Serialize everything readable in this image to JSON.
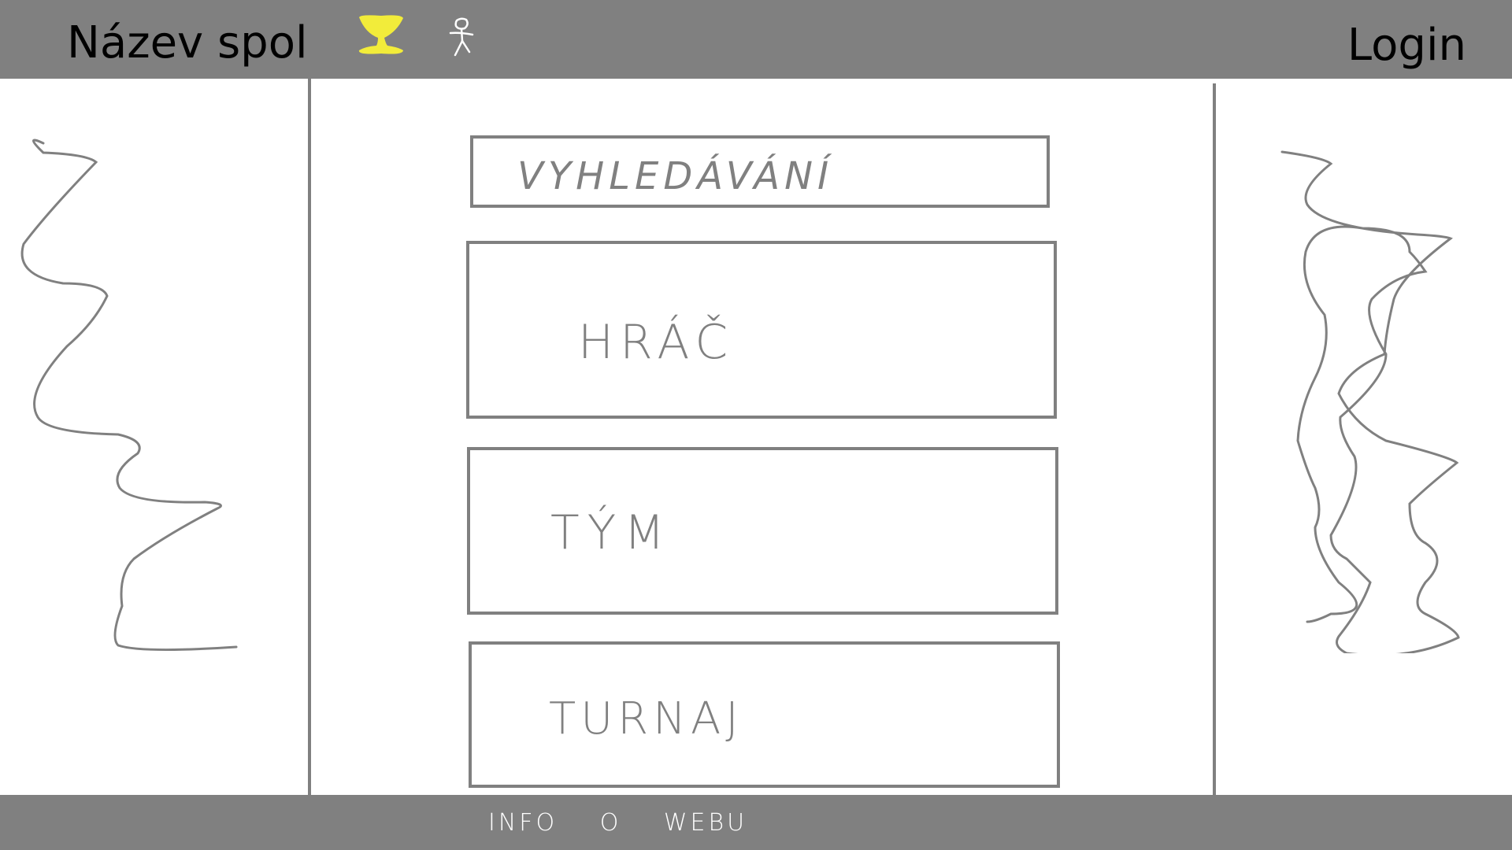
{
  "header": {
    "company_name": "Název spol",
    "login_label": "Login",
    "icons": [
      "trophy-icon",
      "person-icon"
    ],
    "background_color": "#808080",
    "trophy_color": "#f2ec3a"
  },
  "main": {
    "search_label": "VYHLEDÁVÁNÍ",
    "games_label": "HRÁČ",
    "team_label": "TÝM",
    "tournaments_label": "TURNAJ",
    "line_color": "#808080"
  },
  "footer": {
    "text": "INFO O WEBU",
    "background_color": "#808080"
  }
}
